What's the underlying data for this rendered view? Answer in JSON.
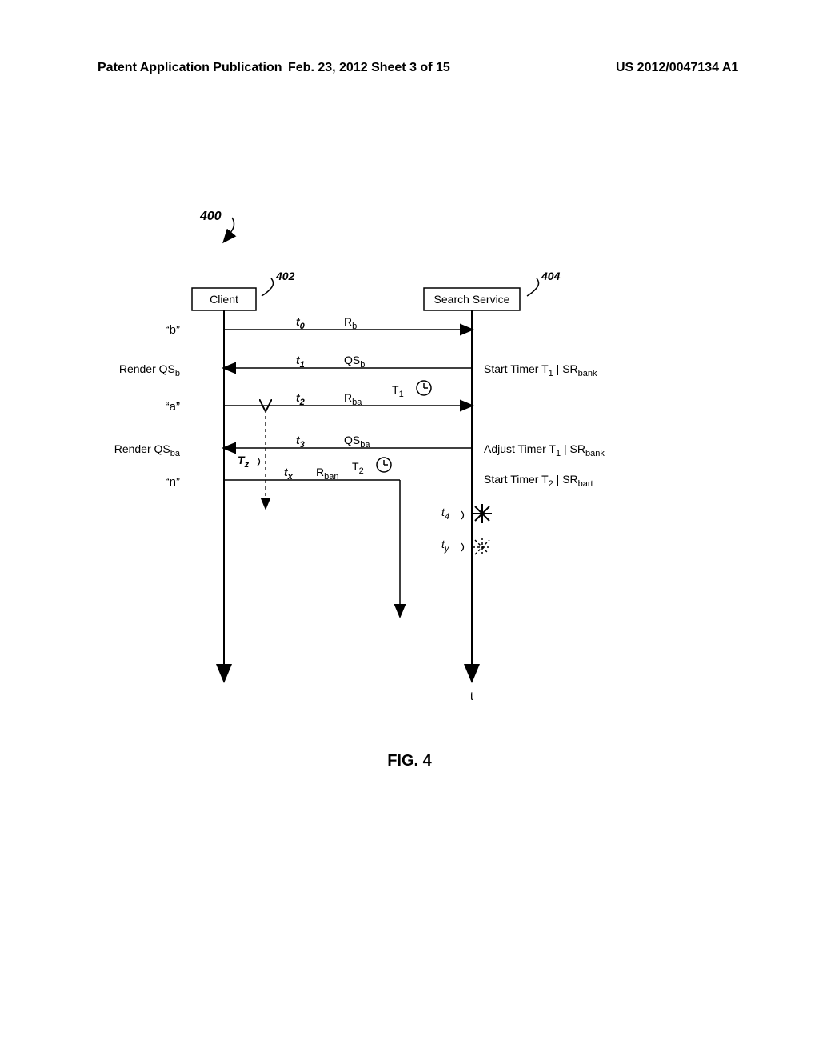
{
  "header": {
    "left": "Patent Application Publication",
    "mid": "Feb. 23, 2012  Sheet 3 of 15",
    "right": "US 2012/0047134 A1"
  },
  "figure_label": "FIG. 4",
  "ref400": "400",
  "ref402": "402",
  "ref404": "404",
  "box_client": "Client",
  "box_service": "Search Service",
  "client_side": {
    "b": "“b”",
    "render_qsb": "Render QS",
    "render_qsb_sub": "b",
    "a": "“a”",
    "render_qsba": "Render QS",
    "render_qsba_sub": "ba",
    "n": "“n”"
  },
  "messages": {
    "t0": "t",
    "t0_sub": "0",
    "t1": "t",
    "t1_sub": "1",
    "t2": "t",
    "t2_sub": "2",
    "t3": "t",
    "t3_sub": "3",
    "tx": "t",
    "tx_sub": "x",
    "Rb": "R",
    "Rb_sub": "b",
    "QSb": "QS",
    "QSb_sub": "b",
    "T1": "T",
    "T1_sub": "1",
    "Rba": "R",
    "Rba_sub": "ba",
    "QSba": "QS",
    "QSba_sub": "ba",
    "T2": "T",
    "T2_sub": "2",
    "Rban": "R",
    "Rban_sub": "ban",
    "Tz": "T",
    "Tz_sub": "z"
  },
  "server_side": {
    "start_t1": "Start Timer T",
    "start_t1_sub": "1",
    "start_t1_tail": " | SR",
    "start_t1_tail_sub": "bank",
    "adjust_t1": "Adjust Timer T",
    "adjust_t1_sub": "1",
    "adjust_t1_tail": " | SR",
    "adjust_t1_tail_sub": "bank",
    "start_t2": "Start Timer T",
    "start_t2_sub": "2",
    "start_t2_tail": " | SR",
    "start_t2_tail_sub": "bart"
  },
  "t4": "t",
  "t4_sub": "4",
  "ty": "t",
  "ty_sub": "y",
  "t_axis": "t"
}
